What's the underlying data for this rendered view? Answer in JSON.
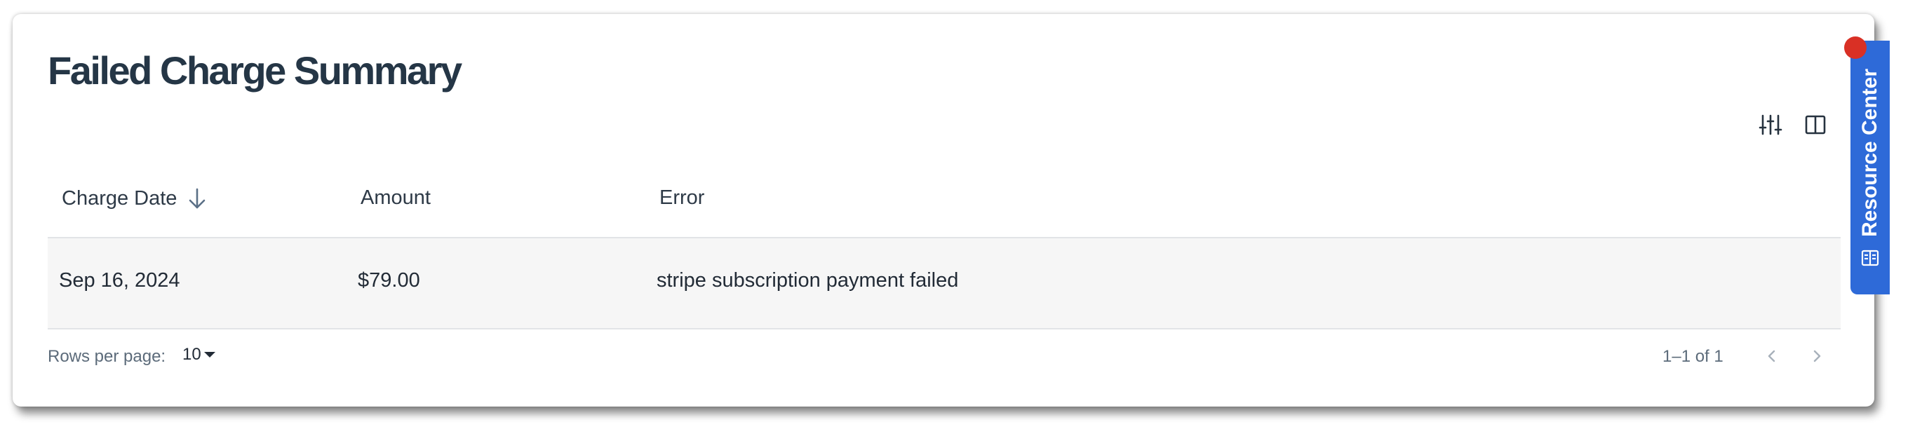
{
  "page": {
    "title": "Failed Charge Summary"
  },
  "toolbar": {
    "filter_icon": "sliders-icon",
    "columns_icon": "column-layout-icon"
  },
  "table": {
    "columns": [
      "Charge Date",
      "Amount",
      "Error"
    ],
    "sort_icon": "arrow-down-icon",
    "rows": [
      {
        "date": "Sep 16, 2024",
        "amount": "$79.00",
        "error": "stripe subscription payment failed"
      }
    ]
  },
  "pagination": {
    "rows_per_page_label": "Rows per page:",
    "rows_per_page_value": "10",
    "range_text": "1–1 of 1"
  },
  "resource_center": {
    "label": "Resource Center",
    "icon": "book-icon",
    "badge_color": "#d93025",
    "tab_color": "#2e6ad8"
  }
}
